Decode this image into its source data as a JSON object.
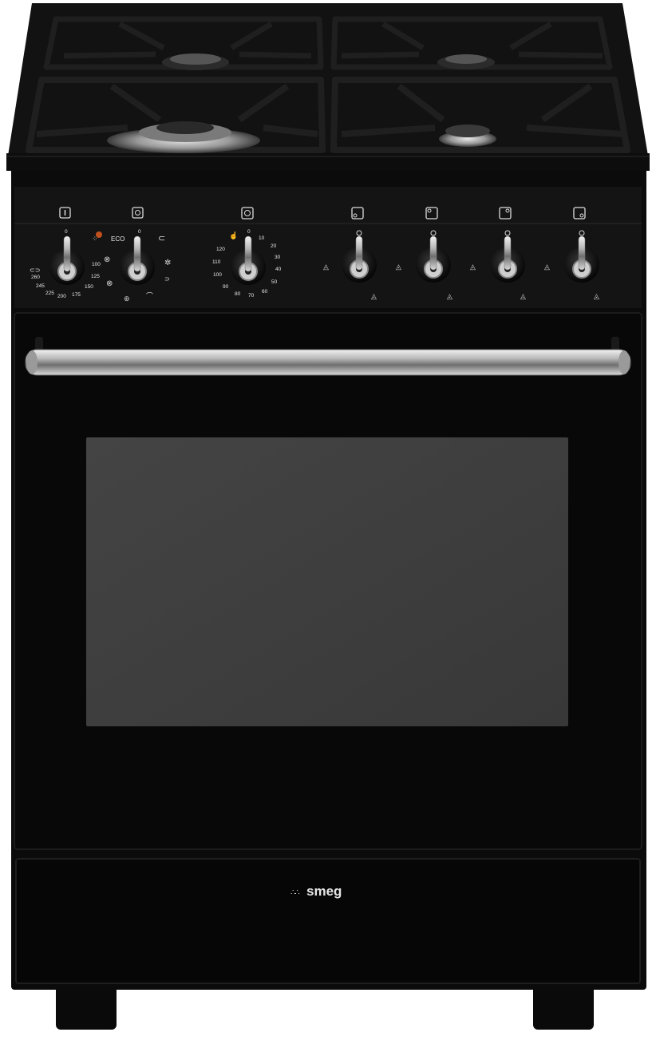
{
  "brand": {
    "logo_text": "smeg"
  },
  "panel": {
    "eco_label": "ECO",
    "icons": [
      "thermometer-icon",
      "oven-function-icon",
      "timer-icon",
      "burner-front-left-icon",
      "burner-rear-left-icon",
      "burner-rear-right-icon",
      "burner-front-right-icon"
    ],
    "thermostat_scale": [
      "0",
      "100",
      "125",
      "150",
      "175",
      "200",
      "225",
      "245",
      "260"
    ],
    "function_scale": [
      "0"
    ],
    "timer_scale": [
      "0",
      "10",
      "20",
      "30",
      "40",
      "50",
      "60",
      "70",
      "80",
      "90",
      "100",
      "110",
      "120"
    ],
    "burner_knobs": 4
  },
  "colors": {
    "body": "#0b0b0b",
    "panel": "#141414",
    "glass": "#3d3d3d",
    "chrome": "#c9c9c9",
    "eco_indicator": "#c0501e"
  }
}
